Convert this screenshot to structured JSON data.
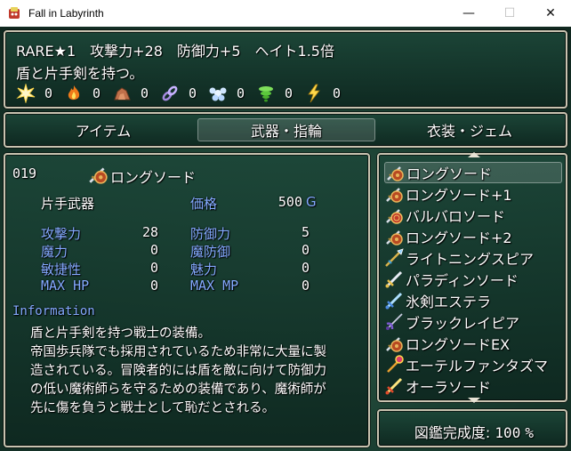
{
  "window": {
    "title": "Fall in Labyrinth",
    "minimize": "—",
    "maximize": "☐",
    "close": "✕"
  },
  "help": {
    "line1": "RARE★1　攻撃力+28　防御力+5　ヘイト1.5倍",
    "line2": "盾と片手剣を持つ。",
    "resists": [
      {
        "icon": "burst-icon",
        "value": "0"
      },
      {
        "icon": "fire-icon",
        "value": "0"
      },
      {
        "icon": "rock-icon",
        "value": "0"
      },
      {
        "icon": "chain-icon",
        "value": "0"
      },
      {
        "icon": "ice-icon",
        "value": "0"
      },
      {
        "icon": "wind-icon",
        "value": "0"
      },
      {
        "icon": "lightning-icon",
        "value": "0"
      }
    ]
  },
  "categories": {
    "items": "アイテム",
    "weapons": "武器・指輪",
    "costumes": "衣装・ジェム",
    "selected": "weapons"
  },
  "status": {
    "id": "019",
    "name": "ロングソード",
    "type": "片手武器",
    "price_label": "価格",
    "price": "500",
    "currency": "G",
    "stats": {
      "atk_label": "攻撃力",
      "atk": "28",
      "def_label": "防御力",
      "def": "5",
      "mat_label": "魔力",
      "mat": "0",
      "mdf_label": "魔防御",
      "mdf": "0",
      "agi_label": "敏捷性",
      "agi": "0",
      "luk_label": "魅力",
      "luk": "0",
      "mhp_label": "MAX HP",
      "mhp": "0",
      "mmp_label": "MAX MP",
      "mmp": "0"
    },
    "info_label": "Information",
    "info_lines": [
      "盾と片手剣を持つ戦士の装備。",
      "帝国歩兵隊でも採用されているため非常に大量に製",
      "造されている。冒険者的には盾を敵に向けて防御力",
      "の低い魔術師らを守るための装備であり、魔術師が",
      "先に傷を負うと戦士として恥だとされる。"
    ]
  },
  "list": {
    "selected_index": 0,
    "items": [
      {
        "name": "ロングソード",
        "icon": "sword-shield-icon"
      },
      {
        "name": "ロングソード+1",
        "icon": "sword-shield-icon"
      },
      {
        "name": "バルバロソード",
        "icon": "sword-shield-icon"
      },
      {
        "name": "ロングソード+2",
        "icon": "sword-shield-icon"
      },
      {
        "name": "ライトニングスピア",
        "icon": "spear-icon"
      },
      {
        "name": "パラディンソード",
        "icon": "sword-icon"
      },
      {
        "name": "氷剣エステラ",
        "icon": "ice-sword-icon"
      },
      {
        "name": "ブラックレイピア",
        "icon": "rapier-icon"
      },
      {
        "name": "ロングソードEX",
        "icon": "sword-shield-icon"
      },
      {
        "name": "エーテルファンタズマ",
        "icon": "staff-icon"
      },
      {
        "name": "オーラソード",
        "icon": "sword-icon"
      }
    ]
  },
  "completion": {
    "label": "図鑑完成度:",
    "value": "100",
    "unit": "%"
  }
}
